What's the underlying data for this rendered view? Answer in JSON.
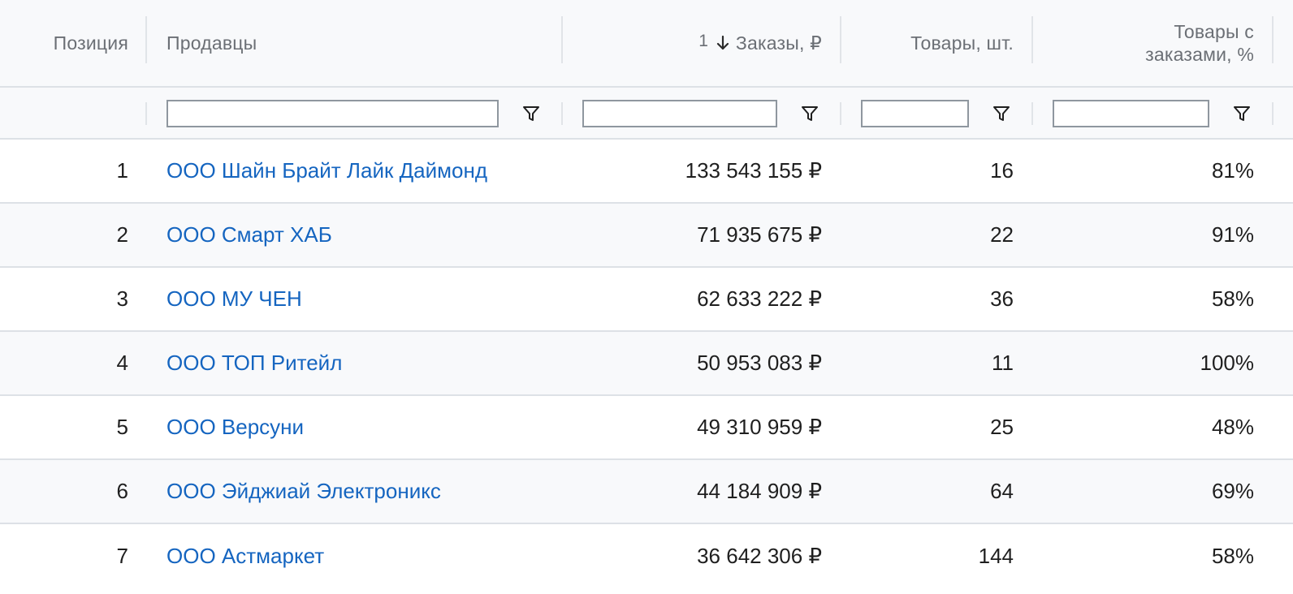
{
  "headers": {
    "position": "Позиция",
    "sellers": "Продавцы",
    "sort_index": "1",
    "orders": "Заказы, ₽",
    "items": "Товары, шт.",
    "items_with_orders_line1": "Товары с",
    "items_with_orders_line2": "заказами, %"
  },
  "filters": {
    "sellers": "",
    "orders": "",
    "items": "",
    "items_with_orders": ""
  },
  "colors": {
    "link": "#1565c0",
    "header_bg": "#f8f9fb",
    "header_text": "#6b6f75",
    "border": "#dde1e6"
  },
  "rows": [
    {
      "position": "1",
      "seller": "ООО Шайн Брайт Лайк Даймонд",
      "orders": "133 543 155 ₽",
      "items": "16",
      "pct": "81%"
    },
    {
      "position": "2",
      "seller": "ООО Смарт ХАБ",
      "orders": "71 935 675 ₽",
      "items": "22",
      "pct": "91%"
    },
    {
      "position": "3",
      "seller": "ООО МУ ЧЕН",
      "orders": "62 633 222 ₽",
      "items": "36",
      "pct": "58%"
    },
    {
      "position": "4",
      "seller": "ООО ТОП Ритейл",
      "orders": "50 953 083 ₽",
      "items": "11",
      "pct": "100%"
    },
    {
      "position": "5",
      "seller": "ООО Версуни",
      "orders": "49 310 959 ₽",
      "items": "25",
      "pct": "48%"
    },
    {
      "position": "6",
      "seller": "ООО Эйджиай Электроникс",
      "orders": "44 184 909 ₽",
      "items": "64",
      "pct": "69%"
    },
    {
      "position": "7",
      "seller": "ООО Астмаркет",
      "orders": "36 642 306 ₽",
      "items": "144",
      "pct": "58%"
    }
  ]
}
